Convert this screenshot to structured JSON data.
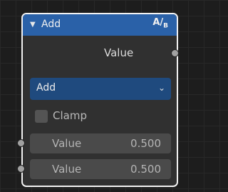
{
  "node": {
    "title": "Add",
    "type_icon": "A/B",
    "type_icon_top": "A",
    "type_icon_bottom": "B",
    "output_label": "Value",
    "operation": "Add",
    "clamp_label": "Clamp",
    "clamp_checked": false,
    "inputs": [
      {
        "label": "Value",
        "value": "0.500"
      },
      {
        "label": "Value",
        "value": "0.500"
      }
    ]
  },
  "colors": {
    "header": "#2a61a8",
    "dropdown": "#1f4a7e",
    "node_body": "#303030",
    "socket": "#a1a1a1"
  },
  "icons": {
    "collapse": "triangle-down",
    "dropdown": "chevron-down"
  }
}
